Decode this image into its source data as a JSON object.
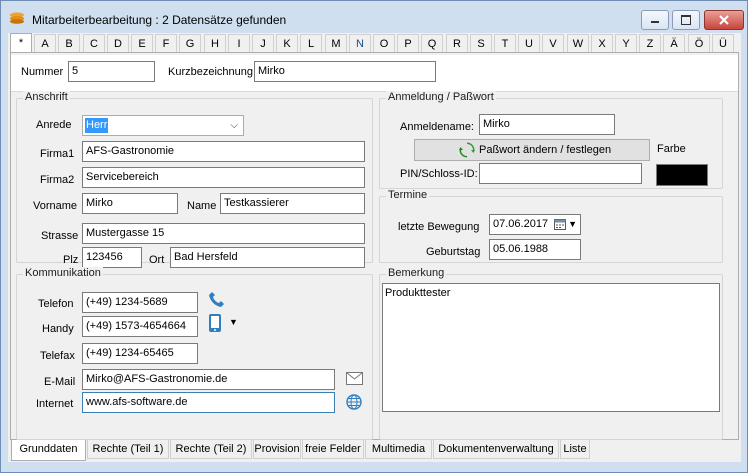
{
  "window": {
    "title": "Mitarbeiterbearbeitung : 2 Datensätze gefunden"
  },
  "alpha_tabs": [
    "*",
    "A",
    "B",
    "C",
    "D",
    "E",
    "F",
    "G",
    "H",
    "I",
    "J",
    "K",
    "L",
    "M",
    "N",
    "O",
    "P",
    "Q",
    "R",
    "S",
    "T",
    "U",
    "V",
    "W",
    "X",
    "Y",
    "Z",
    "Ä",
    "Ö",
    "Ü"
  ],
  "active_alpha_tab": "*",
  "highlighted_alpha_tab": "N",
  "header": {
    "nummer_label": "Nummer",
    "nummer_value": "5",
    "kurz_label": "Kurzbezeichnung",
    "kurz_value": "Mirko"
  },
  "anschrift": {
    "title": "Anschrift",
    "anrede_label": "Anrede",
    "anrede_value": "Herr",
    "firma1_label": "Firma1",
    "firma1_value": "AFS-Gastronomie",
    "firma2_label": "Firma2",
    "firma2_value": "Servicebereich",
    "vorname_label": "Vorname",
    "vorname_value": "Mirko",
    "name_label": "Name",
    "name_value": "Testkassierer",
    "strasse_label": "Strasse",
    "strasse_value": "Mustergasse 15",
    "plz_label": "Plz",
    "plz_value": "123456",
    "ort_label": "Ort",
    "ort_value": "Bad Hersfeld"
  },
  "anmeldung": {
    "title": "Anmeldung / Paßwort",
    "anmeldename_label": "Anmeldename:",
    "anmeldename_value": "Mirko",
    "passwort_button": "Paßwort ändern / festlegen",
    "farbe_label": "Farbe",
    "farbe_color": "#000000",
    "pin_label": "PIN/Schloss-ID:",
    "pin_value": ""
  },
  "termine": {
    "title": "Termine",
    "bewegung_label": "letzte Bewegung",
    "bewegung_value": "07.06.2017",
    "geburtstag_label": "Geburtstag",
    "geburtstag_value": "05.06.1988"
  },
  "kommunikation": {
    "title": "Kommunikation",
    "telefon_label": "Telefon",
    "telefon_value": "(+49) 1234-5689",
    "handy_label": "Handy",
    "handy_value": "(+49) 1573-4654664",
    "telefax_label": "Telefax",
    "telefax_value": "(+49) 1234-65465",
    "email_label": "E-Mail",
    "email_value": "Mirko@AFS-Gastronomie.de",
    "internet_label": "Internet",
    "internet_value": "www.afs-software.de"
  },
  "bemerkung": {
    "title": "Bemerkung",
    "value": "Produkttester"
  },
  "bottom_tabs": [
    "Grunddaten",
    "Rechte (Teil 1)",
    "Rechte (Teil 2)",
    "Provision",
    "freie Felder",
    "Multimedia",
    "Dokumentenverwaltung",
    "Liste"
  ],
  "active_bottom_tab": "Grunddaten"
}
